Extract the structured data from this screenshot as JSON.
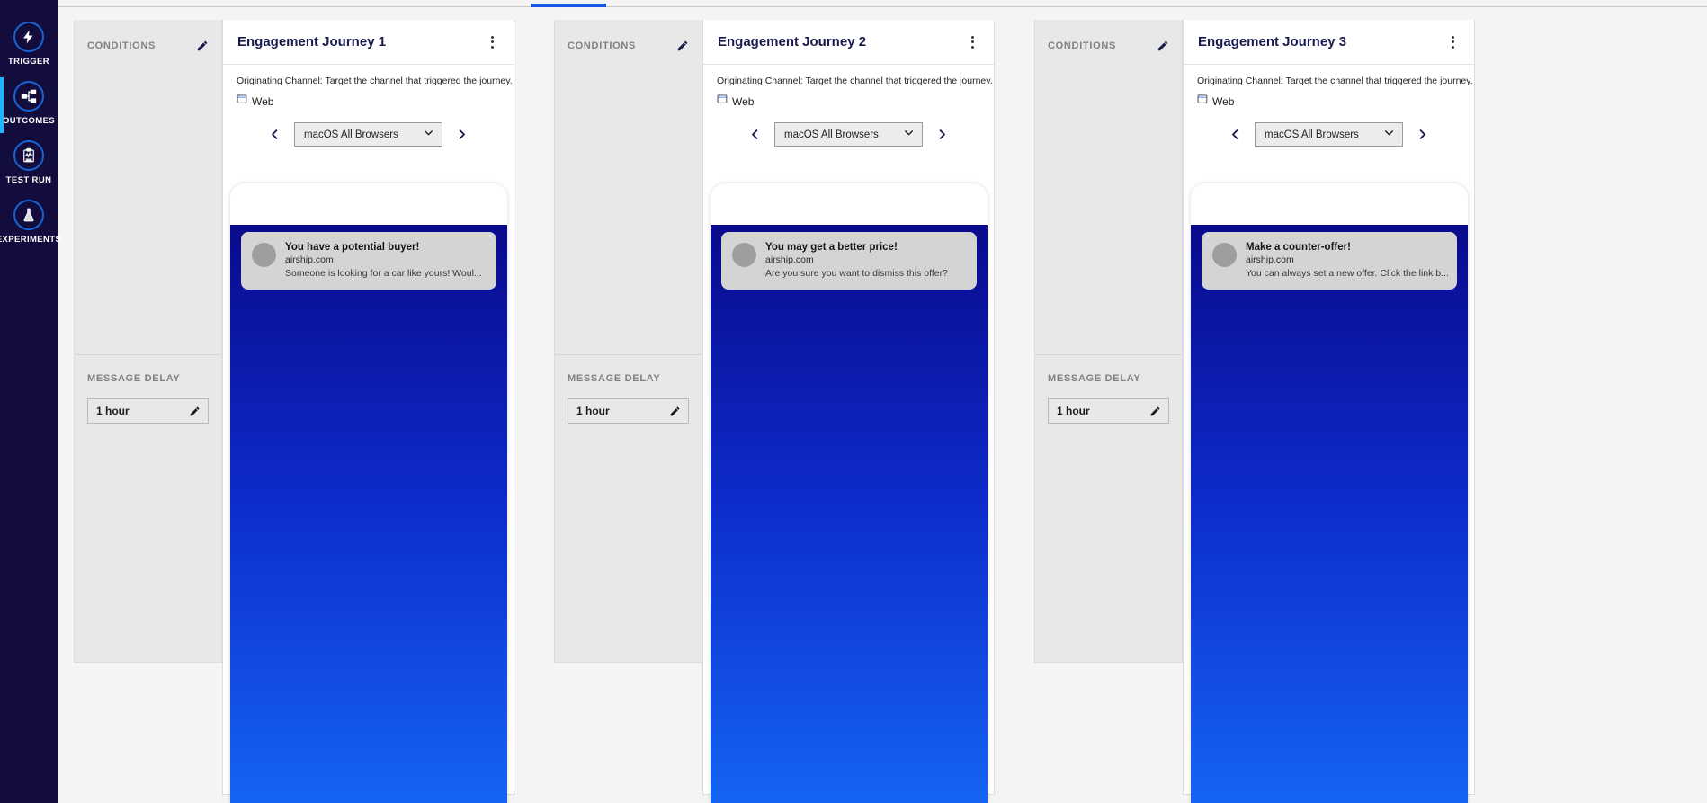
{
  "sidebar": {
    "items": [
      {
        "label": "TRIGGER",
        "icon": "bolt-icon",
        "active": false
      },
      {
        "label": "OUTCOMES",
        "icon": "branch-icon",
        "active": true
      },
      {
        "label": "TEST RUN",
        "icon": "clipboard-icon",
        "active": false
      },
      {
        "label": "EXPERIMENTS",
        "icon": "flask-icon",
        "active": false
      }
    ]
  },
  "settings": {
    "conditions_label": "CONDITIONS",
    "message_delay_label": "MESSAGE DELAY",
    "delay_value": "1 hour"
  },
  "journeys": [
    {
      "title": "Engagement Journey 1",
      "channel_note": "Originating Channel: Target the channel that triggered the journey.",
      "channel_label": "Web",
      "platform": "macOS All Browsers",
      "notification": {
        "title": "You have a potential buyer!",
        "domain": "airship.com",
        "message": "Someone is looking for a car like yours! Woul..."
      }
    },
    {
      "title": "Engagement Journey 2",
      "channel_note": "Originating Channel: Target the channel that triggered the journey.",
      "channel_label": "Web",
      "platform": "macOS All Browsers",
      "notification": {
        "title": "You may get a better price!",
        "domain": "airship.com",
        "message": "Are you sure you want to dismiss this offer?"
      }
    },
    {
      "title": "Engagement Journey 3",
      "channel_note": "Originating Channel: Target the channel that triggered the journey.",
      "channel_label": "Web",
      "platform": "macOS All Browsers",
      "notification": {
        "title": "Make a counter-offer!",
        "domain": "airship.com",
        "message": "You can always set a new offer. Click the link b..."
      }
    }
  ],
  "colors": {
    "sidebar_bg": "#120d3d",
    "accent_blue": "#1a56e8",
    "active_marker": "#1fb6ff",
    "icon_ring": "#1763d8",
    "canvas_bg": "#f4f4f4",
    "panel_bg": "#e8e8e8",
    "title_navy": "#191b4f",
    "screen_top": "#0a0a8c",
    "screen_bottom": "#1563f5"
  }
}
